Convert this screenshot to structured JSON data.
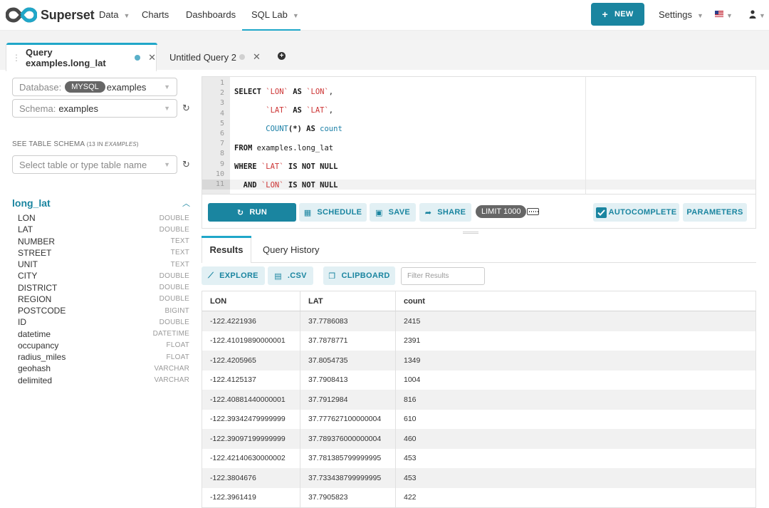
{
  "nav": {
    "brand": "Superset",
    "items": [
      {
        "label": "Data",
        "has_caret": true
      },
      {
        "label": "Charts",
        "has_caret": false
      },
      {
        "label": "Dashboards",
        "has_caret": false
      },
      {
        "label": "SQL Lab",
        "has_caret": true,
        "active": true
      }
    ],
    "new_button": "NEW",
    "settings": "Settings",
    "accent": "#20a7c9",
    "primary": "#1a85a0"
  },
  "tabs": [
    {
      "label": "Query examples.long_lat",
      "active": true,
      "status_color": "#5ab0c9"
    },
    {
      "label": "Untitled Query 2",
      "active": false,
      "status_color": "#d0d0d0"
    }
  ],
  "left": {
    "database_label": "Database:",
    "database_badge": "MYSQL",
    "database_value": "examples",
    "schema_label": "Schema:",
    "schema_value": "examples",
    "schema_caption": "SEE TABLE SCHEMA",
    "schema_caption_count": "(13 IN ",
    "schema_caption_schema": "EXAMPLES",
    "schema_caption_end": ")",
    "table_placeholder": "Select table or type table name",
    "table_name": "long_lat",
    "columns": [
      {
        "name": "LON",
        "type": "DOUBLE"
      },
      {
        "name": "LAT",
        "type": "DOUBLE"
      },
      {
        "name": "NUMBER",
        "type": "TEXT"
      },
      {
        "name": "STREET",
        "type": "TEXT"
      },
      {
        "name": "UNIT",
        "type": "TEXT"
      },
      {
        "name": "CITY",
        "type": "DOUBLE"
      },
      {
        "name": "DISTRICT",
        "type": "DOUBLE"
      },
      {
        "name": "REGION",
        "type": "DOUBLE"
      },
      {
        "name": "POSTCODE",
        "type": "BIGINT"
      },
      {
        "name": "ID",
        "type": "DOUBLE"
      },
      {
        "name": "datetime",
        "type": "DATETIME"
      },
      {
        "name": "occupancy",
        "type": "FLOAT"
      },
      {
        "name": "radius_miles",
        "type": "FLOAT"
      },
      {
        "name": "geohash",
        "type": "VARCHAR"
      },
      {
        "name": "delimited",
        "type": "VARCHAR"
      }
    ]
  },
  "editor": {
    "line_numbers": [
      "1",
      "2",
      "3",
      "4",
      "5",
      "6",
      "7",
      "8",
      "9",
      "10",
      "11"
    ]
  },
  "toolbar": {
    "run": "RUN",
    "schedule": "SCHEDULE",
    "save": "SAVE",
    "share": "SHARE",
    "limit": "LIMIT 1000",
    "autocomplete": "AUTOCOMPLETE",
    "parameters": "PARAMETERS"
  },
  "results": {
    "tabs": [
      "Results",
      "Query History"
    ],
    "explore": "EXPLORE",
    "csv": ".CSV",
    "clipboard": "CLIPBOARD",
    "filter_placeholder": "Filter Results",
    "columns": [
      "LON",
      "LAT",
      "count"
    ],
    "rows": [
      [
        "-122.4221936",
        "37.7786083",
        "2415"
      ],
      [
        "-122.41019890000001",
        "37.7878771",
        "2391"
      ],
      [
        "-122.4205965",
        "37.8054735",
        "1349"
      ],
      [
        "-122.4125137",
        "37.7908413",
        "1004"
      ],
      [
        "-122.40881440000001",
        "37.7912984",
        "816"
      ],
      [
        "-122.39342479999999",
        "37.777627100000004",
        "610"
      ],
      [
        "-122.39097199999999",
        "37.789376000000004",
        "460"
      ],
      [
        "-122.42140630000002",
        "37.781385799999995",
        "453"
      ],
      [
        "-122.3804676",
        "37.733438799999995",
        "453"
      ],
      [
        "-122.3961419",
        "37.7905823",
        "422"
      ]
    ]
  }
}
